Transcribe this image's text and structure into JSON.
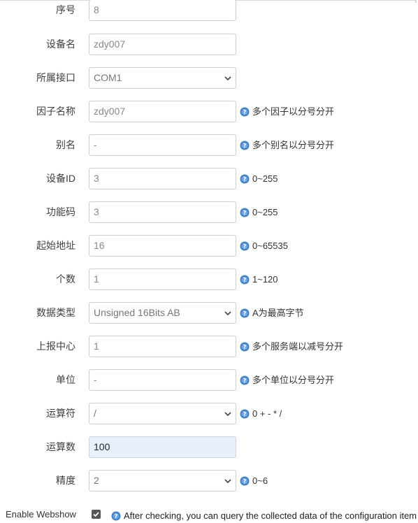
{
  "fields": [
    {
      "label": "序号",
      "value": "8",
      "type": "input",
      "hint": ""
    },
    {
      "label": "设备名",
      "value": "zdy007",
      "type": "input",
      "hint": ""
    },
    {
      "label": "所属接口",
      "value": "COM1",
      "type": "select",
      "hint": ""
    },
    {
      "label": "因子名称",
      "value": "zdy007",
      "type": "input",
      "hint": "多个因子以分号分开"
    },
    {
      "label": "别名",
      "value": "-",
      "type": "input",
      "hint": "多个别名以分号分开"
    },
    {
      "label": "设备ID",
      "value": "3",
      "type": "input",
      "hint": "0~255"
    },
    {
      "label": "功能码",
      "value": "3",
      "type": "input",
      "hint": "0~255"
    },
    {
      "label": "起始地址",
      "value": "16",
      "type": "input",
      "hint": "0~65535"
    },
    {
      "label": "个数",
      "value": "1",
      "type": "input",
      "hint": "1~120"
    },
    {
      "label": "数据类型",
      "value": "Unsigned 16Bits AB",
      "type": "select",
      "hint": "A为最高字节"
    },
    {
      "label": "上报中心",
      "value": "1",
      "type": "input",
      "hint": "多个服务端以减号分开"
    },
    {
      "label": "单位",
      "value": "-",
      "type": "input",
      "hint": "多个单位以分号分开"
    },
    {
      "label": "运算符",
      "value": "/",
      "type": "select",
      "hint": "0 + - * /"
    },
    {
      "label": "运算数",
      "value": "100",
      "type": "input",
      "hint": "",
      "focused": true
    },
    {
      "label": "精度",
      "value": "2",
      "type": "select",
      "hint": "0~6"
    }
  ],
  "enable_webshow": {
    "label": "Enable Webshow",
    "checked": true,
    "hint": "After checking, you can query the collected data of the configuration item"
  },
  "colors": {
    "help_icon": "#3f7fc9",
    "focused_bg": "#e8f0fe"
  }
}
